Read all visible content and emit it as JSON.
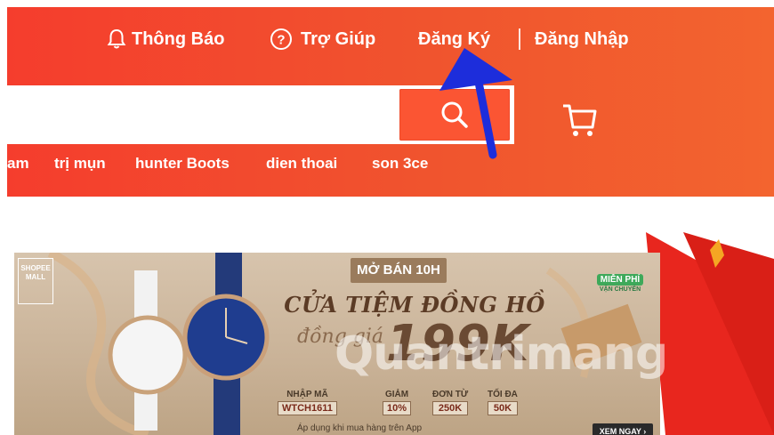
{
  "topnav": {
    "notifications": "Thông Báo",
    "help": "Trợ Giúp",
    "register": "Đăng Ký",
    "login": "Đăng Nhập"
  },
  "keywords": [
    "am",
    "trị mụn",
    "hunter Boots",
    "dien thoai",
    "son 3ce"
  ],
  "banner": {
    "tag": "MỞ BÁN 10H",
    "title": "CỬA TIỆM ĐỒNG HỒ",
    "price_prefix": "đồng giá",
    "price": "199K",
    "code_label": "NHẬP MÃ",
    "code_value": "WTCH1611",
    "discount_label": "GIẢM",
    "discount_value": "10%",
    "min_order_label": "ĐƠN TỪ",
    "min_order_value": "250K",
    "max_label": "TỐI ĐA",
    "max_value": "50K",
    "app_note": "Áp dụng khi mua hàng trên App",
    "cta": "XEM NGAY ›",
    "badge": "MIỄN PHÍ",
    "badge_sub": "VẬN CHUYỂN",
    "mini_logo": "SHOPEE MALL"
  },
  "watermark": "Quantrimang",
  "colors": {
    "header_bg": "#f53d2d",
    "search_btn": "#fb5533",
    "annotation_arrow": "#1d2ddb"
  },
  "icons": {
    "bell": "bell-icon",
    "help": "question-circle-icon",
    "search": "search-icon",
    "cart": "cart-icon"
  }
}
